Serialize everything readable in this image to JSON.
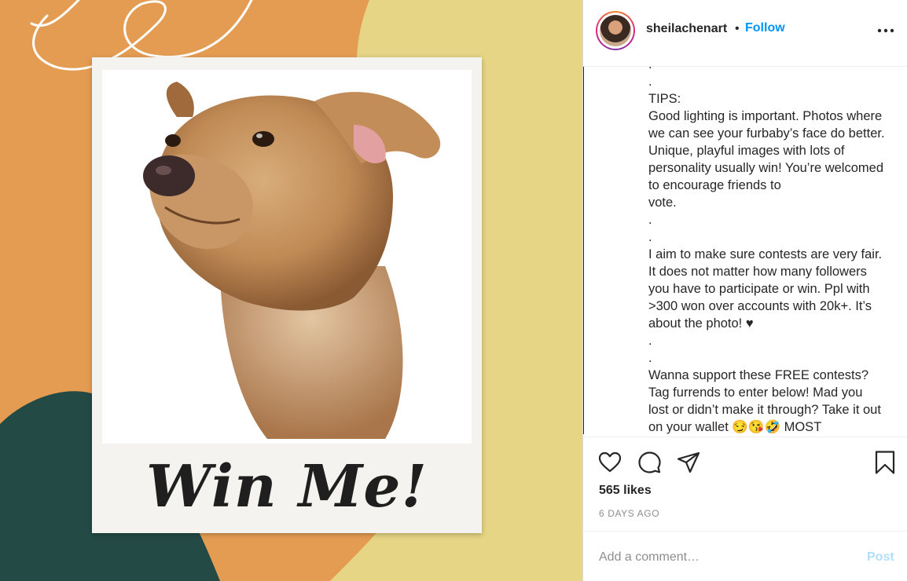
{
  "post": {
    "image": {
      "caption_text": "Win Me!",
      "colors": {
        "background_orange": "#e49c52",
        "yellow_blob": "#e5d584",
        "green_blob": "#244a46",
        "polaroid": "#f4f3ef"
      },
      "subject": "watercolor dog portrait"
    },
    "header": {
      "username": "sheilachenart",
      "separator": "•",
      "follow_label": "Follow"
    },
    "caption_lines": [
      ".",
      ".",
      "TIPS:",
      "Good lighting is important. Photos where",
      "we can see your furbaby’s face do better.",
      "Unique, playful images with lots of",
      "personality usually win! You’re welcomed",
      "to encourage friends to",
      "vote.",
      ".",
      ".",
      "I aim to make sure contests are very fair.",
      "It does not matter how many followers",
      "you have to participate or win. Ppl with",
      ">300 won over accounts with 20k+. It’s",
      "about the photo! ♥",
      ".",
      ".",
      "Wanna support these FREE contests?",
      "Tag furrends to enter below! Mad you",
      "lost or didn’t make it through? Take it out",
      "on your wallet 😏😘🤣 MOST"
    ],
    "likes_text": "565 likes",
    "time_ago": "6 DAYS AGO",
    "comment": {
      "placeholder": "Add a comment…",
      "value": "",
      "post_label": "Post"
    },
    "icons": [
      "heart-icon",
      "comment-icon",
      "share-icon",
      "bookmark-icon",
      "more-options-icon"
    ],
    "colors": {
      "link_blue": "#0095f6",
      "post_disabled": "#b2dffc",
      "text": "#262626",
      "muted": "#8e8e8e"
    }
  }
}
